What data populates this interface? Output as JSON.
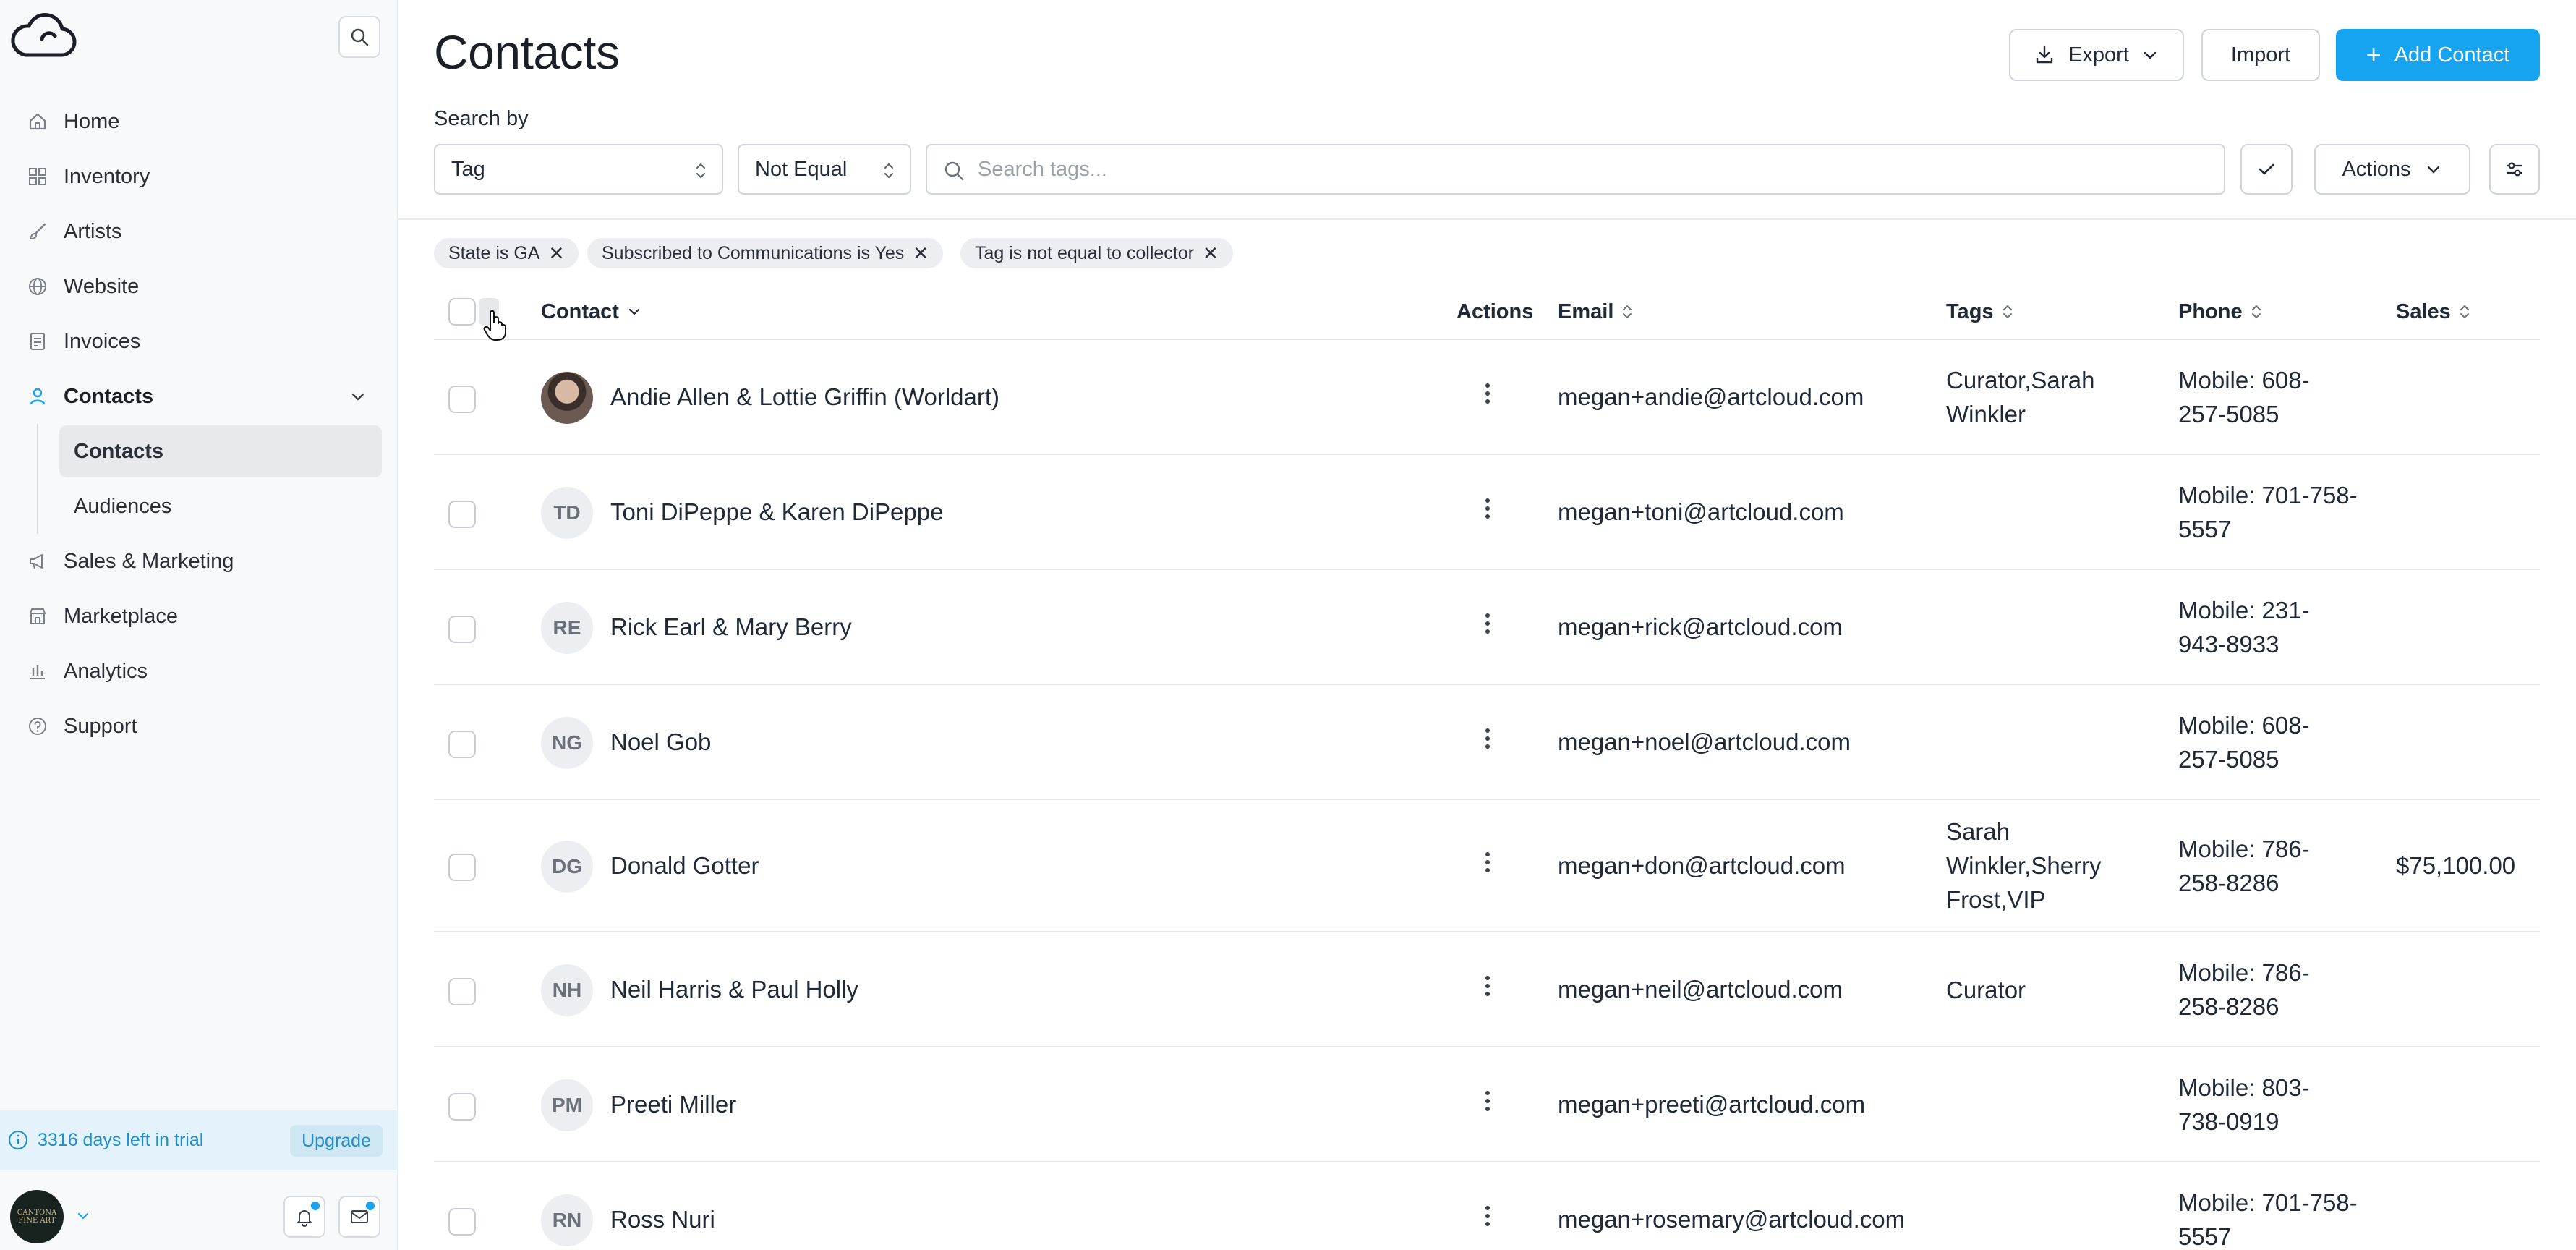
{
  "sidebar": {
    "logo_icon": "cloud-logo-icon",
    "nav": [
      {
        "label": "Home",
        "icon": "home-icon"
      },
      {
        "label": "Inventory",
        "icon": "grid-icon"
      },
      {
        "label": "Artists",
        "icon": "brush-icon"
      },
      {
        "label": "Website",
        "icon": "globe-icon"
      },
      {
        "label": "Invoices",
        "icon": "document-icon"
      },
      {
        "label": "Contacts",
        "icon": "person-icon"
      },
      {
        "label": "Sales & Marketing",
        "icon": "megaphone-icon"
      },
      {
        "label": "Marketplace",
        "icon": "store-icon"
      },
      {
        "label": "Analytics",
        "icon": "bar-chart-icon"
      },
      {
        "label": "Support",
        "icon": "help-icon"
      }
    ],
    "contacts_sub": [
      {
        "label": "Contacts"
      },
      {
        "label": "Audiences"
      }
    ],
    "trial_text": "3316 days left in trial",
    "upgrade_label": "Upgrade",
    "avatar_text": "CANTONA FINE ART",
    "accent_color": "#16a3ef"
  },
  "header": {
    "title": "Contacts",
    "export_label": "Export",
    "import_label": "Import",
    "add_label": "Add Contact"
  },
  "search": {
    "label": "Search by",
    "field_value": "Tag",
    "operator_value": "Not Equal",
    "placeholder": "Search tags...",
    "actions_label": "Actions"
  },
  "filters": [
    {
      "label": "State is GA"
    },
    {
      "label": "Subscribed to Communications is Yes"
    },
    {
      "label": "Tag is not equal to collector"
    }
  ],
  "table": {
    "columns": {
      "contact": "Contact",
      "actions": "Actions",
      "email": "Email",
      "tags": "Tags",
      "phone": "Phone",
      "sales": "Sales"
    },
    "rows": [
      {
        "initials": "",
        "name": "Andie Allen & Lottie Griffin (Worldart)",
        "email": "megan+andie@artcloud.com",
        "tags": [
          "Curator,Sarah",
          "Winkler"
        ],
        "phone": [
          "Mobile: 608-",
          "257-5085"
        ],
        "sales": ""
      },
      {
        "initials": "TD",
        "name": "Toni DiPeppe & Karen DiPeppe",
        "email": "megan+toni@artcloud.com",
        "tags": [],
        "phone": [
          "Mobile: 701-758-",
          "5557"
        ],
        "sales": ""
      },
      {
        "initials": "RE",
        "name": "Rick Earl & Mary Berry",
        "email": "megan+rick@artcloud.com",
        "tags": [],
        "phone": [
          "Mobile: 231-",
          "943-8933"
        ],
        "sales": ""
      },
      {
        "initials": "NG",
        "name": "Noel Gob",
        "email": "megan+noel@artcloud.com",
        "tags": [],
        "phone": [
          "Mobile: 608-",
          "257-5085"
        ],
        "sales": ""
      },
      {
        "initials": "DG",
        "name": "Donald Gotter",
        "email": "megan+don@artcloud.com",
        "tags": [
          "Sarah",
          "Winkler,Sherry",
          "Frost,VIP"
        ],
        "phone": [
          "Mobile: 786-",
          "258-8286"
        ],
        "sales": "$75,100.00"
      },
      {
        "initials": "NH",
        "name": "Neil Harris & Paul Holly",
        "email": "megan+neil@artcloud.com",
        "tags": [
          "Curator"
        ],
        "phone": [
          "Mobile: 786-",
          "258-8286"
        ],
        "sales": ""
      },
      {
        "initials": "PM",
        "name": "Preeti Miller",
        "email": "megan+preeti@artcloud.com",
        "tags": [],
        "phone": [
          "Mobile: 803-",
          "738-0919"
        ],
        "sales": ""
      },
      {
        "initials": "RN",
        "name": "Ross Nuri",
        "email": "megan+rosemary@artcloud.com",
        "tags": [],
        "phone": [
          "Mobile: 701-758-",
          "5557"
        ],
        "sales": ""
      }
    ]
  }
}
